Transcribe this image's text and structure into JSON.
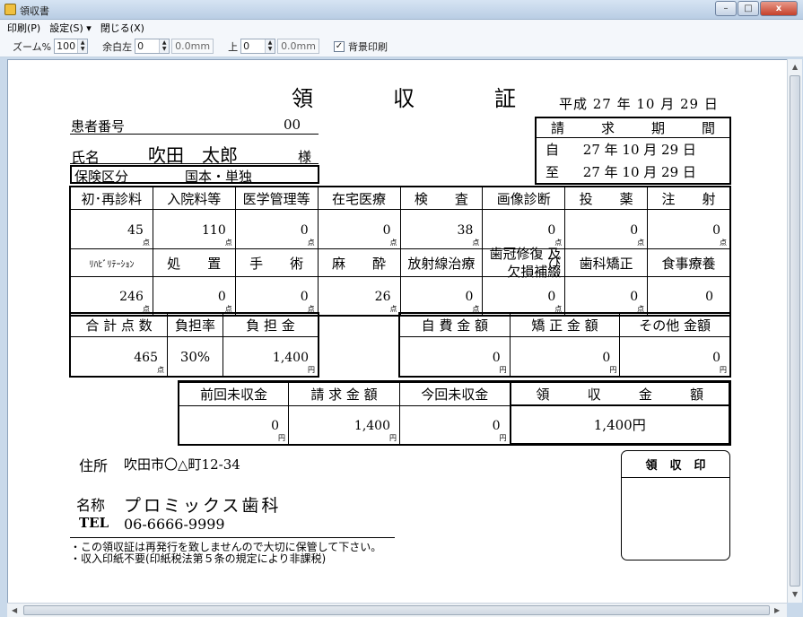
{
  "window": {
    "title": "領収書",
    "buttons": [
      "–",
      "□",
      "x"
    ]
  },
  "menu": {
    "items": [
      "印刷(P)",
      "設定(S) ▾",
      "閉じる(X)"
    ]
  },
  "toolbar": {
    "zoom_label": "ズーム%",
    "zoom_value": "100",
    "left_margin_label": "余白左",
    "left_margin_value": "0",
    "left_margin_mm": "0.0mm",
    "top_margin_label": "上",
    "top_margin_value": "0",
    "top_margin_mm": "0.0mm",
    "bg_print_label": "背景印刷",
    "bg_print_checked": "✓"
  },
  "receipt": {
    "title_chars": [
      "領",
      "収",
      "証"
    ],
    "date": "平成 27 年 10 月 29 日",
    "patient_no_label": "患者番号",
    "patient_no": "00",
    "name_label": "氏名",
    "name": "吹田　太郎",
    "honorific": "様",
    "insurance_label": "保険区分",
    "insurance": "国本・単独",
    "period": {
      "header_chars": [
        "請",
        "求",
        "期",
        "間"
      ],
      "from_label": "自",
      "from": "27 年 10 月 29 日",
      "to_label": "至",
      "to": "27 年 10 月 29 日"
    },
    "row1_headers": [
      "初･再診料",
      "入院料等",
      "医学管理等",
      "在宅医療",
      "検　　査",
      "画像診断",
      "投　　薬",
      "注　　射"
    ],
    "row1_values": [
      "45",
      "110",
      "0",
      "0",
      "38",
      "0",
      "0",
      "0"
    ],
    "row2_headers": [
      "ﾘﾊﾋﾞﾘﾃｰｼｮﾝ",
      "処　　置",
      "手　　術",
      "麻　　酔",
      "放射線治療",
      "歯冠修復 及び\n欠損補綴",
      "歯科矯正",
      "食事療養"
    ],
    "row2_values": [
      "246",
      "0",
      "0",
      "26",
      "0",
      "0",
      "0",
      "0"
    ],
    "point_unit": "点",
    "yen_unit": "円",
    "totals": {
      "headers": [
        "合 計 点 数",
        "負担率",
        "負 担 金"
      ],
      "values": [
        "465",
        "30%",
        "1,400"
      ]
    },
    "self_pay": {
      "headers": [
        "自 費 金 額",
        "矯 正 金 額",
        "その他 金額"
      ],
      "values": [
        "0",
        "0",
        "0"
      ]
    },
    "billing": {
      "headers": [
        "前回未収金",
        "請 求 金 額",
        "今回未収金"
      ],
      "values": [
        "0",
        "1,400",
        "0"
      ],
      "received_header_chars": [
        "領",
        "収",
        "金",
        "額"
      ],
      "received_amount": "1,400円"
    },
    "address_label": "住所",
    "address": "吹田市〇△町12-34",
    "clinic_label": "名称",
    "clinic": "プロミックス歯科",
    "tel_label": "TEL",
    "tel": "06-6666-9999",
    "seal_chars": [
      "領",
      "収",
      "印"
    ],
    "notes": [
      "・この領収証は再発行を致しませんので大切に保管して下さい。",
      "・収入印紙不要(印紙税法第５条の規定により非課税)"
    ]
  }
}
